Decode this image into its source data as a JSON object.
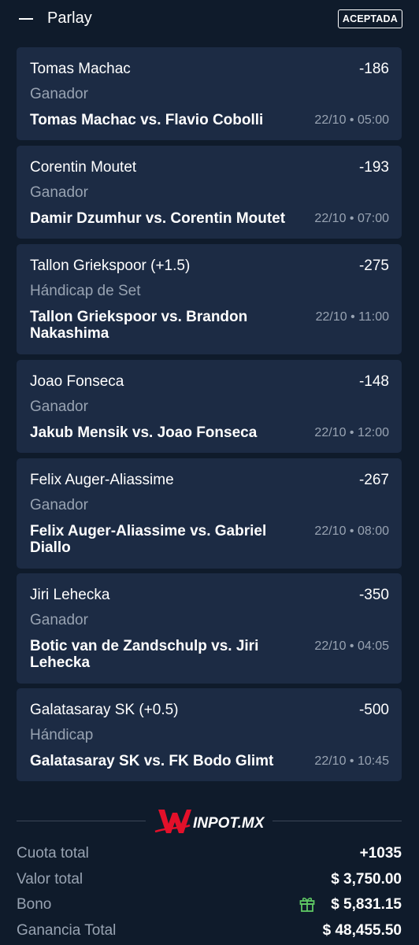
{
  "header": {
    "title": "Parlay",
    "collapse_icon": "minus-icon",
    "status": "ACEPTADA"
  },
  "bets": [
    {
      "selection": "Tomas Machac",
      "odds": "-186",
      "market": "Ganador",
      "event": "Tomas Machac vs. Flavio Cobolli",
      "time": "22/10 • 05:00"
    },
    {
      "selection": "Corentin Moutet",
      "odds": "-193",
      "market": "Ganador",
      "event": "Damir Dzumhur vs. Corentin Moutet",
      "time": "22/10 • 07:00"
    },
    {
      "selection": "Tallon Griekspoor (+1.5)",
      "odds": "-275",
      "market": "Hándicap de Set",
      "event": "Tallon Griekspoor vs. Brandon Nakashima",
      "time": "22/10 • 11:00"
    },
    {
      "selection": "Joao Fonseca",
      "odds": "-148",
      "market": "Ganador",
      "event": "Jakub Mensik vs. Joao Fonseca",
      "time": "22/10 • 12:00"
    },
    {
      "selection": "Felix Auger-Aliassime",
      "odds": "-267",
      "market": "Ganador",
      "event": "Felix Auger-Aliassime vs. Gabriel Diallo",
      "time": "22/10 • 08:00"
    },
    {
      "selection": "Jiri Lehecka",
      "odds": "-350",
      "market": "Ganador",
      "event": "Botic van de Zandschulp vs. Jiri Lehecka",
      "time": "22/10 • 04:05"
    },
    {
      "selection": "Galatasaray SK (+0.5)",
      "odds": "-500",
      "market": "Hándicap",
      "event": "Galatasaray SK vs. FK Bodo Glimt",
      "time": "22/10 • 10:45"
    }
  ],
  "brand": {
    "logo_text": "WINPOT.MX",
    "logo_icon": "winpot-logo",
    "accent_color": "#e3102a"
  },
  "summary": {
    "total_odds_label": "Cuota total",
    "total_odds_value": "+1035",
    "stake_label": "Valor total",
    "stake_value": "$ 3,750.00",
    "bonus_label": "Bono",
    "bonus_icon": "gift-icon",
    "bonus_value": "$ 5,831.15",
    "winnings_label": "Ganancia Total",
    "winnings_value": "$ 48,455.50"
  },
  "colors": {
    "background": "#0f1b2b",
    "card": "#1c2b44",
    "muted_text": "#98a3b2",
    "gift": "#5fc964"
  }
}
